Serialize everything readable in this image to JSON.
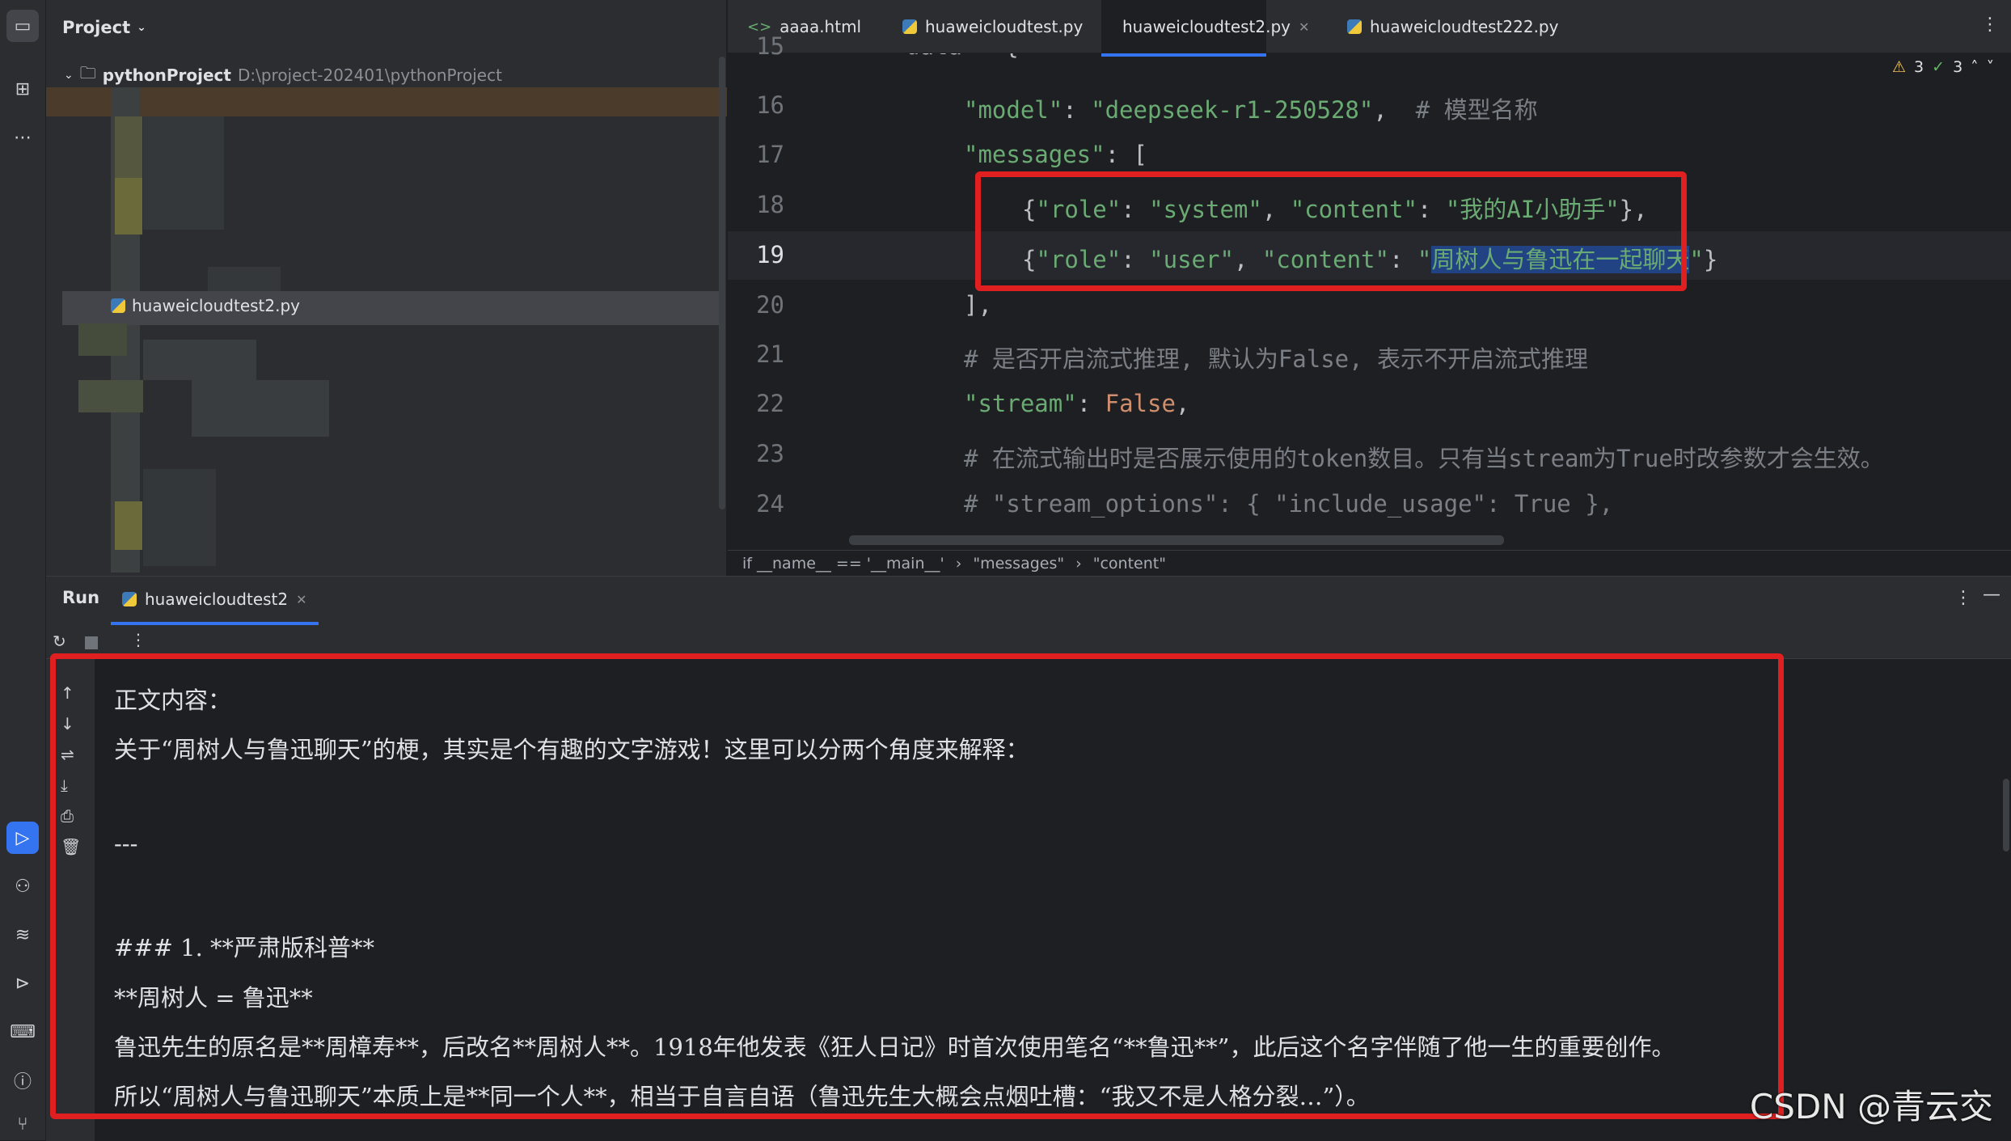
{
  "project_panel": {
    "title": "Project",
    "root_name": "pythonProject",
    "root_path": "D:\\project-202401\\pythonProject",
    "selected_file": "huaweicloudtest2.py"
  },
  "tabs": [
    {
      "label": "aaaa.html",
      "icon": "html-icon"
    },
    {
      "label": "huaweicloudtest.py",
      "icon": "python-icon"
    },
    {
      "label": "huaweicloudtest2.py",
      "icon": "python-icon",
      "active": true
    },
    {
      "label": "huaweicloudtest222.py",
      "icon": "python-icon"
    }
  ],
  "inspections": {
    "warnings": "3",
    "ok": "3"
  },
  "code": {
    "line_numbers": [
      "15",
      "16",
      "17",
      "18",
      "19",
      "20",
      "21",
      "22",
      "23",
      "24"
    ],
    "current_line": "19",
    "line15": "data = {",
    "model_key": "\"model\"",
    "model_val": "\"deepseek-r1-250528\"",
    "model_comment": "# 模型名称",
    "messages_key": "\"messages\"",
    "role_key": "\"role\"",
    "system_val": "\"system\"",
    "content_key": "\"content\"",
    "system_content": "\"我的AI小助手\"",
    "user_val": "\"user\"",
    "user_content": "周树人与鲁迅在一起聊天",
    "comment21": "# 是否开启流式推理, 默认为False, 表示不开启流式推理",
    "stream_key": "\"stream\"",
    "stream_val": "False",
    "comment23": "# 在流式输出时是否展示使用的token数目。只有当stream为True时改参数才会生效。",
    "comment24": "# \"stream_options\": { \"include_usage\": True },"
  },
  "breadcrumb": [
    "if __name__ == '__main__'",
    "\"messages\"",
    "\"content\""
  ],
  "run_panel": {
    "tab_run": "Run",
    "tab_config": "huaweicloudtest2",
    "output": [
      "正文内容：",
      "关于“周树人与鲁迅聊天”的梗，其实是个有趣的文字游戏！这里可以分两个角度来解释：",
      "",
      "---",
      "",
      "### 1. **严肃版科普**",
      "**周树人 = 鲁迅**",
      "鲁迅先生的原名是**周樟寿**，后改名**周树人**。1918年他发表《狂人日记》时首次使用笔名“**鲁迅**”，此后这个名字伴随了他一生的重要创作。",
      "所以“周树人与鲁迅聊天”本质上是**同一个人**，相当于自言自语（鲁迅先生大概会点烟吐槽：“我又不是人格分裂…”）。"
    ]
  },
  "watermark": "CSDN @青云交",
  "colors": {
    "highlight_box": "#e02020",
    "accent": "#3574f0"
  }
}
